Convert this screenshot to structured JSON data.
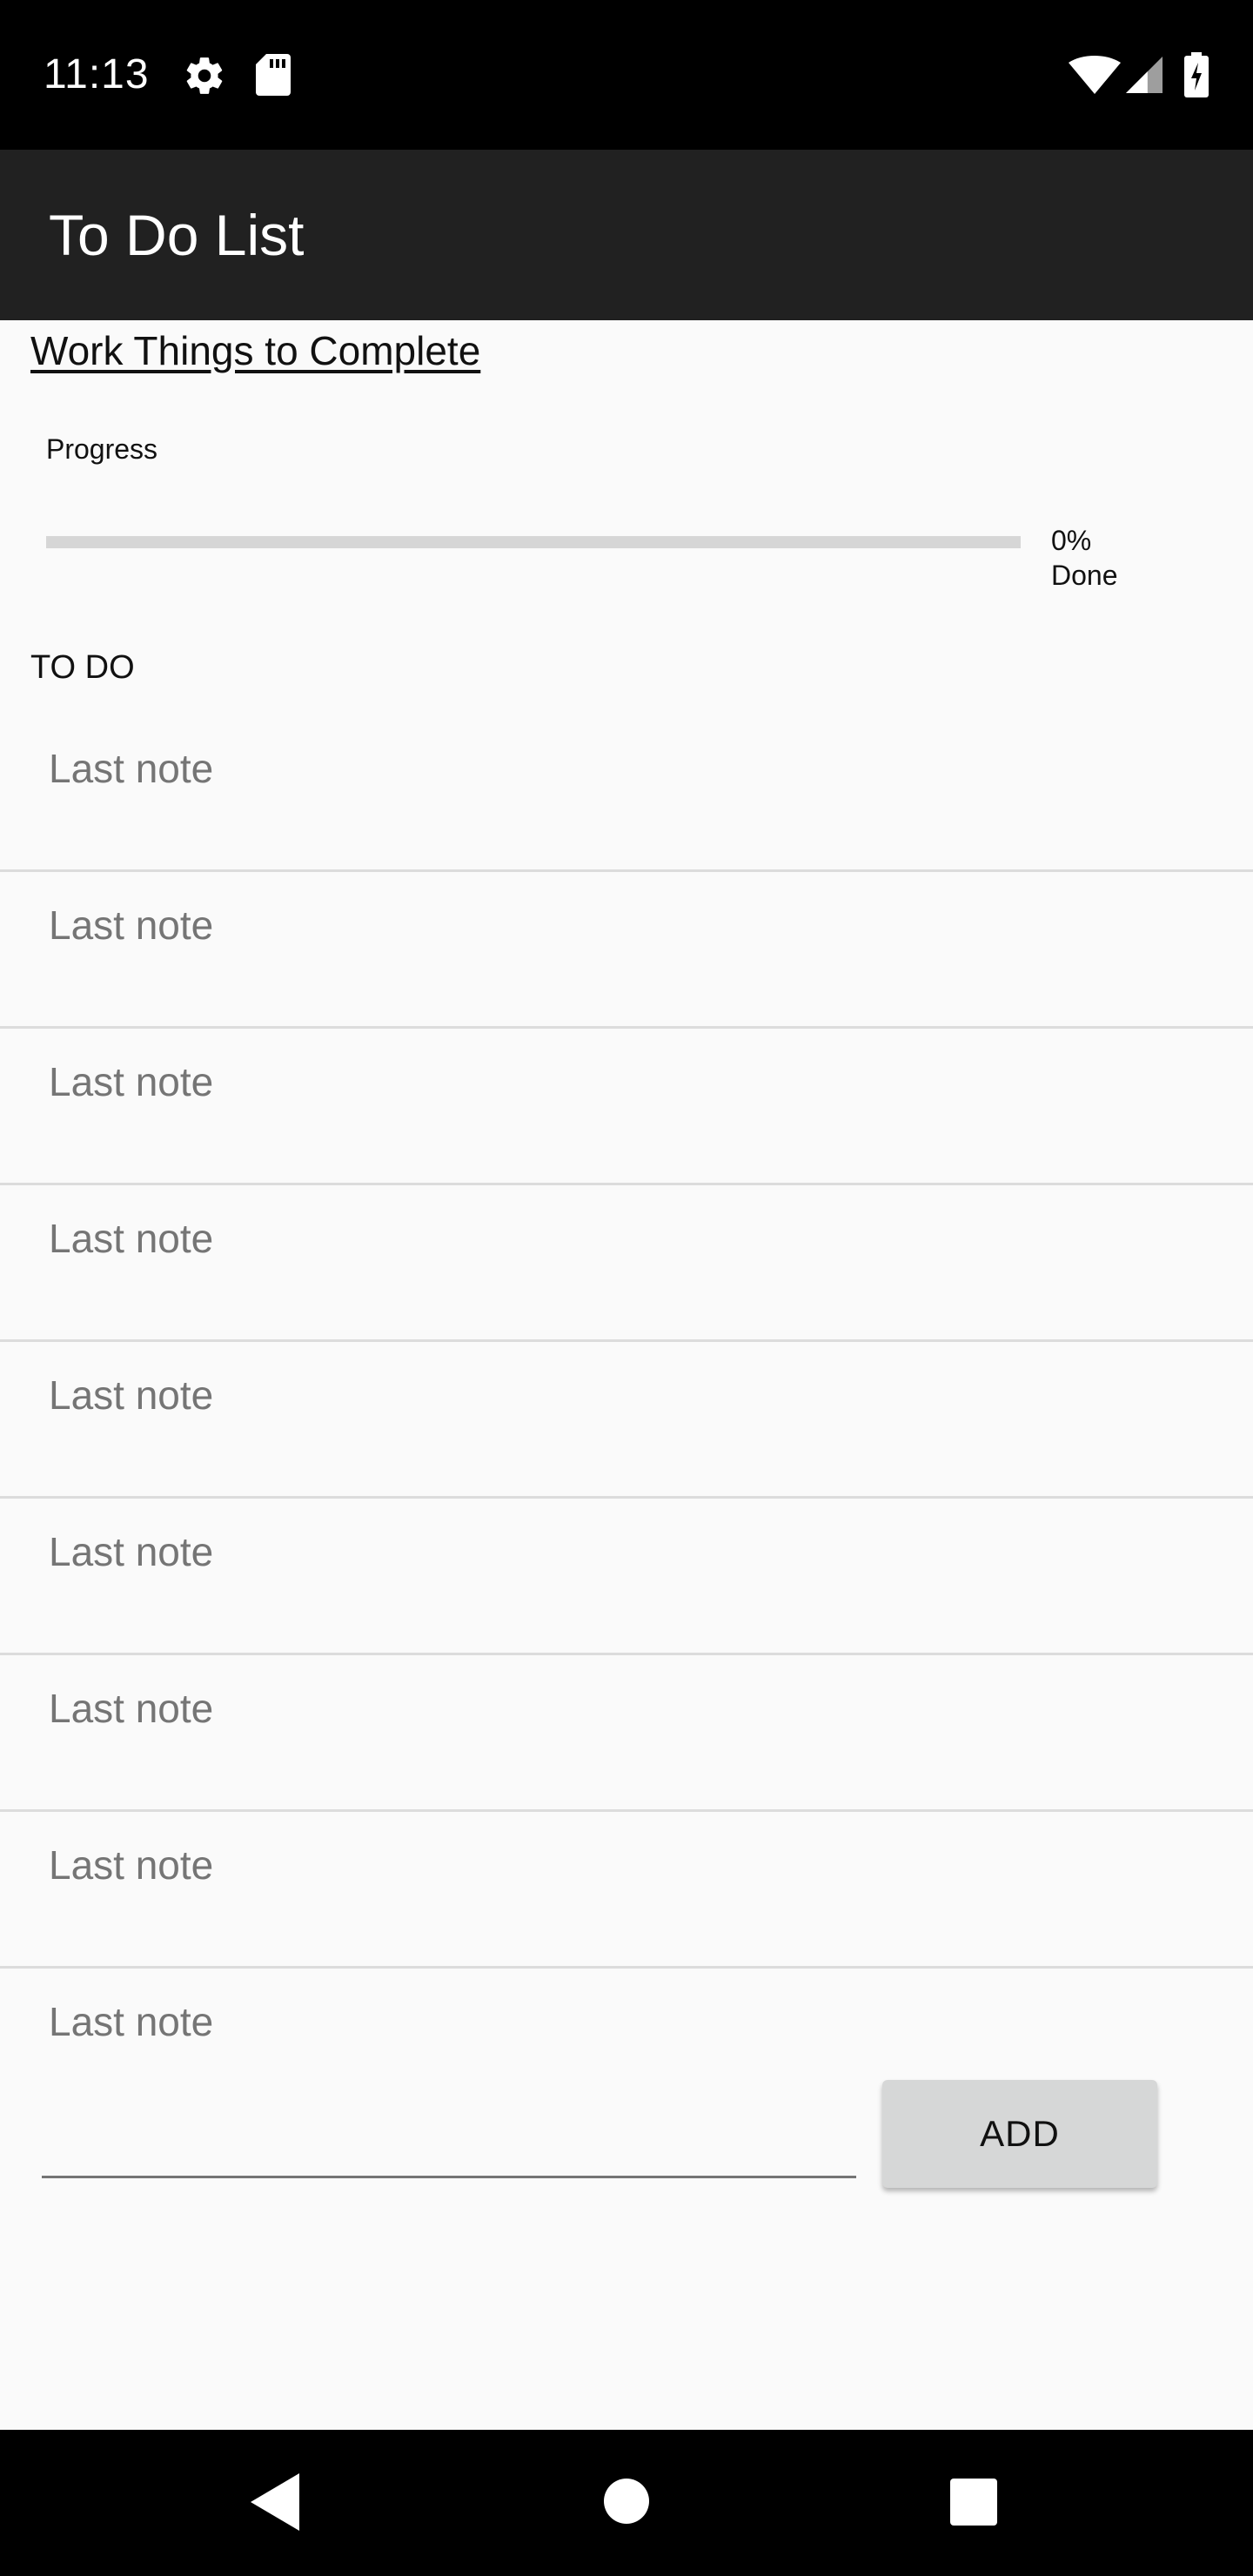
{
  "status_bar": {
    "time": "11:13",
    "icons": [
      "gear-icon",
      "sd-card-icon",
      "wifi-icon",
      "signal-icon",
      "battery-charging-icon"
    ]
  },
  "app_bar": {
    "title": "To Do List"
  },
  "list": {
    "title": "Work Things to Complete"
  },
  "progress": {
    "label": "Progress",
    "percent_text": "0%",
    "done_text": "Done",
    "fraction": 0.0
  },
  "todo": {
    "header": "TO DO",
    "items": [
      {
        "text": "Last note"
      },
      {
        "text": "Last note"
      },
      {
        "text": "Last note"
      },
      {
        "text": "Last note"
      },
      {
        "text": "Last note"
      },
      {
        "text": "Last note"
      },
      {
        "text": "Last note"
      },
      {
        "text": "Last note"
      },
      {
        "text": "Last note"
      }
    ]
  },
  "add_form": {
    "input_value": "",
    "button_label": "ADD"
  },
  "nav_bar": {
    "icons": [
      "back-icon",
      "home-icon",
      "recents-icon"
    ]
  },
  "colors": {
    "status_bar_bg": "#000000",
    "app_bar_bg": "#212121",
    "page_bg": "#fafafa",
    "note_text": "#757575",
    "divider": "#dcdcdc",
    "button_bg": "#d6d7d7"
  }
}
